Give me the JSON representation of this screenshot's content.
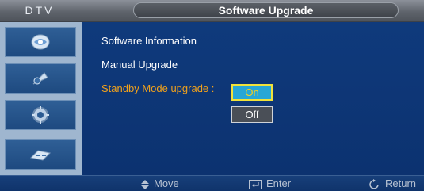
{
  "header": {
    "source_label": "DTV",
    "title": "Software Upgrade"
  },
  "sidebar": {
    "items": [
      {
        "icon": "picture-icon"
      },
      {
        "icon": "sound-icon"
      },
      {
        "icon": "setup-icon"
      },
      {
        "icon": "input-icon"
      }
    ]
  },
  "menu": {
    "items": [
      {
        "label": "Software Information",
        "state": "normal"
      },
      {
        "label": "Manual Upgrade",
        "state": "normal"
      },
      {
        "label": "Standby Mode upgrade :",
        "state": "selected"
      }
    ]
  },
  "dropdown": {
    "options": [
      "On",
      "Off"
    ],
    "selected": "On"
  },
  "footer": {
    "move_label": "Move",
    "enter_label": "Enter",
    "return_label": "Return"
  },
  "colors": {
    "accent_selected": "#f3a21a",
    "panel_blue": "#0f3a7c",
    "highlight_border": "#f1e23a"
  }
}
